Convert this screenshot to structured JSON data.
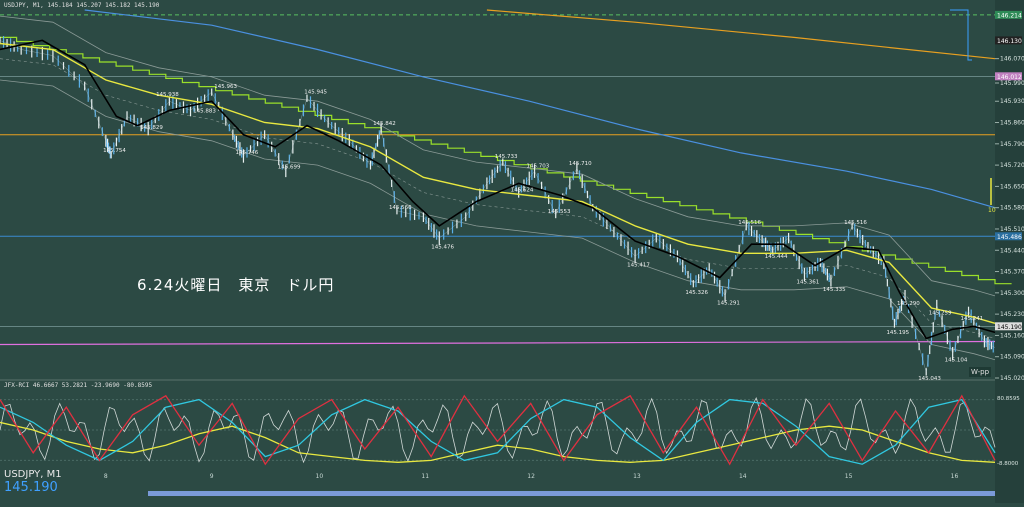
{
  "header_text": "USDJPY, M1, 145.184 145.207 145.182 145.190",
  "osc_header_text": "JFX-RCI 46.6667 53.2821 -23.9690 -80.8595",
  "annotation": "6.24火曜日　東京　ドル円",
  "symbol_label": "USDJPY, M1",
  "current_price_label": "145.190",
  "wpp_label": "W-pp",
  "osc_marker_label": "10",
  "colors": {
    "background": "#2c4a44",
    "price_line": "#ffffff",
    "ma_fast": "#000000",
    "ma_slow": "#e8e840",
    "bollinger": "#8a9a96",
    "envelope_step": "#9ae02a",
    "ma_blue": "#4a90e0",
    "ma_orange": "#e8a020",
    "magenta_line": "#e070e0"
  },
  "chart_data": [
    {
      "type": "line",
      "title": "",
      "y_axis_ticks": [
        "146.070",
        "145.990",
        "145.930",
        "145.860",
        "145.790",
        "145.720",
        "145.650",
        "145.580",
        "145.510",
        "145.440",
        "145.370",
        "145.300",
        "145.230",
        "145.160",
        "145.090",
        "145.020"
      ],
      "y_axis_badges": [
        {
          "label": "146.214",
          "color": "#2e8b57",
          "value": 146.214
        },
        {
          "label": "146.130",
          "color": "#222222",
          "value": 146.13
        },
        {
          "label": "146.012",
          "color": "#c080c0",
          "value": 146.012
        },
        {
          "label": "145.486",
          "color": "#2a6fa0",
          "value": 145.486
        },
        {
          "label": "145.190",
          "color": "#dddddd",
          "value": 145.19
        }
      ],
      "ylim": [
        145.02,
        146.23
      ],
      "x_axis_ticks": [
        "8",
        "9",
        "10",
        "11",
        "12",
        "13",
        "14",
        "15",
        "16"
      ],
      "price_labels": [
        {
          "label": "145.754",
          "x": 8.05,
          "y": 145.754
        },
        {
          "label": "145.829",
          "x": 8.4,
          "y": 145.829
        },
        {
          "label": "145.883",
          "x": 8.9,
          "y": 145.883
        },
        {
          "label": "145.938",
          "x": 8.55,
          "y": 145.938
        },
        {
          "label": "145.963",
          "x": 9.1,
          "y": 145.963
        },
        {
          "label": "145.746",
          "x": 9.3,
          "y": 145.746
        },
        {
          "label": "145.699",
          "x": 9.7,
          "y": 145.699
        },
        {
          "label": "145.945",
          "x": 9.95,
          "y": 145.945
        },
        {
          "label": "145.842",
          "x": 10.6,
          "y": 145.842
        },
        {
          "label": "145.566",
          "x": 10.75,
          "y": 145.566
        },
        {
          "label": "145.476",
          "x": 11.15,
          "y": 145.476
        },
        {
          "label": "145.733",
          "x": 11.75,
          "y": 145.733
        },
        {
          "label": "145.624",
          "x": 11.9,
          "y": 145.624
        },
        {
          "label": "145.703",
          "x": 12.05,
          "y": 145.703
        },
        {
          "label": "145.553",
          "x": 12.25,
          "y": 145.553
        },
        {
          "label": "145.710",
          "x": 12.45,
          "y": 145.71
        },
        {
          "label": "145.417",
          "x": 13.0,
          "y": 145.417
        },
        {
          "label": "145.326",
          "x": 13.55,
          "y": 145.326
        },
        {
          "label": "145.291",
          "x": 13.85,
          "y": 145.291
        },
        {
          "label": "145.516",
          "x": 14.05,
          "y": 145.516
        },
        {
          "label": "145.444",
          "x": 14.3,
          "y": 145.444
        },
        {
          "label": "145.361",
          "x": 14.6,
          "y": 145.361
        },
        {
          "label": "145.335",
          "x": 14.85,
          "y": 145.335
        },
        {
          "label": "145.516",
          "x": 15.05,
          "y": 145.516
        },
        {
          "label": "145.290",
          "x": 15.55,
          "y": 145.29
        },
        {
          "label": "145.195",
          "x": 15.45,
          "y": 145.195
        },
        {
          "label": "145.043",
          "x": 15.75,
          "y": 145.043
        },
        {
          "label": "145.259",
          "x": 15.85,
          "y": 145.259
        },
        {
          "label": "145.104",
          "x": 16.0,
          "y": 145.104
        },
        {
          "label": "145.241",
          "x": 16.15,
          "y": 145.241
        }
      ],
      "price_series": [
        [
          7.0,
          146.13
        ],
        [
          7.2,
          146.1
        ],
        [
          7.5,
          146.08
        ],
        [
          7.8,
          145.98
        ],
        [
          8.0,
          145.8
        ],
        [
          8.05,
          145.754
        ],
        [
          8.2,
          145.88
        ],
        [
          8.4,
          145.84
        ],
        [
          8.6,
          145.93
        ],
        [
          8.8,
          145.9
        ],
        [
          9.0,
          145.96
        ],
        [
          9.2,
          145.82
        ],
        [
          9.3,
          145.75
        ],
        [
          9.5,
          145.82
        ],
        [
          9.7,
          145.7
        ],
        [
          9.9,
          145.94
        ],
        [
          10.1,
          145.86
        ],
        [
          10.3,
          145.8
        ],
        [
          10.5,
          145.72
        ],
        [
          10.6,
          145.84
        ],
        [
          10.75,
          145.57
        ],
        [
          11.0,
          145.55
        ],
        [
          11.15,
          145.48
        ],
        [
          11.4,
          145.55
        ],
        [
          11.6,
          145.66
        ],
        [
          11.75,
          145.73
        ],
        [
          11.9,
          145.63
        ],
        [
          12.05,
          145.7
        ],
        [
          12.25,
          145.56
        ],
        [
          12.45,
          145.71
        ],
        [
          12.6,
          145.58
        ],
        [
          12.8,
          145.5
        ],
        [
          13.0,
          145.42
        ],
        [
          13.2,
          145.48
        ],
        [
          13.4,
          145.42
        ],
        [
          13.55,
          145.33
        ],
        [
          13.7,
          145.38
        ],
        [
          13.85,
          145.29
        ],
        [
          14.05,
          145.52
        ],
        [
          14.2,
          145.47
        ],
        [
          14.3,
          145.44
        ],
        [
          14.45,
          145.48
        ],
        [
          14.6,
          145.36
        ],
        [
          14.75,
          145.4
        ],
        [
          14.85,
          145.34
        ],
        [
          15.05,
          145.52
        ],
        [
          15.2,
          145.45
        ],
        [
          15.35,
          145.4
        ],
        [
          15.45,
          145.2
        ],
        [
          15.55,
          145.29
        ],
        [
          15.75,
          145.04
        ],
        [
          15.85,
          145.26
        ],
        [
          16.0,
          145.1
        ],
        [
          16.15,
          145.24
        ],
        [
          16.3,
          145.14
        ],
        [
          16.4,
          145.12
        ]
      ],
      "ma_fast_series": [
        [
          7.0,
          146.1
        ],
        [
          7.4,
          146.13
        ],
        [
          7.8,
          146.05
        ],
        [
          8.1,
          145.88
        ],
        [
          8.3,
          145.85
        ],
        [
          8.6,
          145.9
        ],
        [
          9.0,
          145.93
        ],
        [
          9.3,
          145.82
        ],
        [
          9.6,
          145.78
        ],
        [
          9.9,
          145.85
        ],
        [
          10.2,
          145.8
        ],
        [
          10.6,
          145.72
        ],
        [
          10.9,
          145.6
        ],
        [
          11.15,
          145.52
        ],
        [
          11.5,
          145.6
        ],
        [
          11.9,
          145.66
        ],
        [
          12.3,
          145.62
        ],
        [
          12.6,
          145.58
        ],
        [
          13.0,
          145.47
        ],
        [
          13.4,
          145.42
        ],
        [
          13.8,
          145.35
        ],
        [
          14.1,
          145.46
        ],
        [
          14.4,
          145.46
        ],
        [
          14.7,
          145.39
        ],
        [
          15.0,
          145.45
        ],
        [
          15.3,
          145.44
        ],
        [
          15.5,
          145.3
        ],
        [
          15.75,
          145.15
        ],
        [
          16.0,
          145.18
        ],
        [
          16.2,
          145.19
        ],
        [
          16.4,
          145.17
        ]
      ],
      "ma_slow_series": [
        [
          7.0,
          146.12
        ],
        [
          7.5,
          146.1
        ],
        [
          8.0,
          146.0
        ],
        [
          8.5,
          145.95
        ],
        [
          9.0,
          145.92
        ],
        [
          9.5,
          145.86
        ],
        [
          10.0,
          145.84
        ],
        [
          10.5,
          145.78
        ],
        [
          11.0,
          145.68
        ],
        [
          11.5,
          145.64
        ],
        [
          12.0,
          145.62
        ],
        [
          12.5,
          145.6
        ],
        [
          13.0,
          145.52
        ],
        [
          13.5,
          145.46
        ],
        [
          14.0,
          145.43
        ],
        [
          14.5,
          145.43
        ],
        [
          15.0,
          145.44
        ],
        [
          15.4,
          145.4
        ],
        [
          15.8,
          145.25
        ],
        [
          16.2,
          145.22
        ],
        [
          16.4,
          145.2
        ]
      ],
      "ma_blue_series": [
        [
          7.8,
          146.23
        ],
        [
          9.0,
          146.18
        ],
        [
          10.0,
          146.1
        ],
        [
          11.0,
          146.01
        ],
        [
          12.0,
          145.93
        ],
        [
          13.0,
          145.84
        ],
        [
          14.0,
          145.76
        ],
        [
          15.0,
          145.7
        ],
        [
          15.8,
          145.64
        ],
        [
          16.4,
          145.58
        ]
      ],
      "ma_orange_series": [
        [
          11.6,
          146.23
        ],
        [
          13.0,
          146.19
        ],
        [
          14.5,
          146.14
        ],
        [
          16.4,
          146.07
        ]
      ],
      "orange_horizontal": 145.82,
      "magenta_line": [
        [
          7.0,
          145.13
        ],
        [
          16.4,
          145.14
        ]
      ],
      "blue_horizontal": 145.486,
      "green_dashed_top": 146.214
    },
    {
      "type": "line",
      "title": "",
      "y_axis_ticks": [
        "80.8595",
        "-8.8000"
      ],
      "ylim": [
        -100,
        100
      ],
      "x_axis_ticks": [
        "8",
        "9",
        "10",
        "11",
        "12",
        "13",
        "14",
        "15",
        "16"
      ],
      "series": [
        {
          "color": "#e8e840",
          "values": [
            20,
            0,
            -30,
            -50,
            -60,
            -40,
            -10,
            10,
            -20,
            -60,
            -70,
            -80,
            -85,
            -80,
            -60,
            -40,
            -50,
            -70,
            -80,
            -85,
            -80,
            -60,
            -40,
            -20,
            0,
            10,
            0,
            -30,
            -60,
            -80,
            -85
          ]
        },
        {
          "color": "#30c8e0",
          "values": [
            60,
            20,
            -40,
            -80,
            -30,
            60,
            80,
            20,
            -70,
            -40,
            40,
            80,
            50,
            -30,
            -80,
            -60,
            30,
            80,
            60,
            -20,
            -80,
            20,
            80,
            70,
            10,
            -70,
            -90,
            -40,
            60,
            80,
            -60
          ]
        },
        {
          "color": "#e03040",
          "values": [
            80,
            -60,
            60,
            -80,
            40,
            90,
            -40,
            70,
            -90,
            30,
            80,
            -50,
            60,
            -70,
            90,
            -30,
            70,
            -80,
            40,
            90,
            -60,
            60,
            -90,
            80,
            -40,
            70,
            -80,
            50,
            -60,
            90,
            -80
          ]
        }
      ]
    }
  ]
}
